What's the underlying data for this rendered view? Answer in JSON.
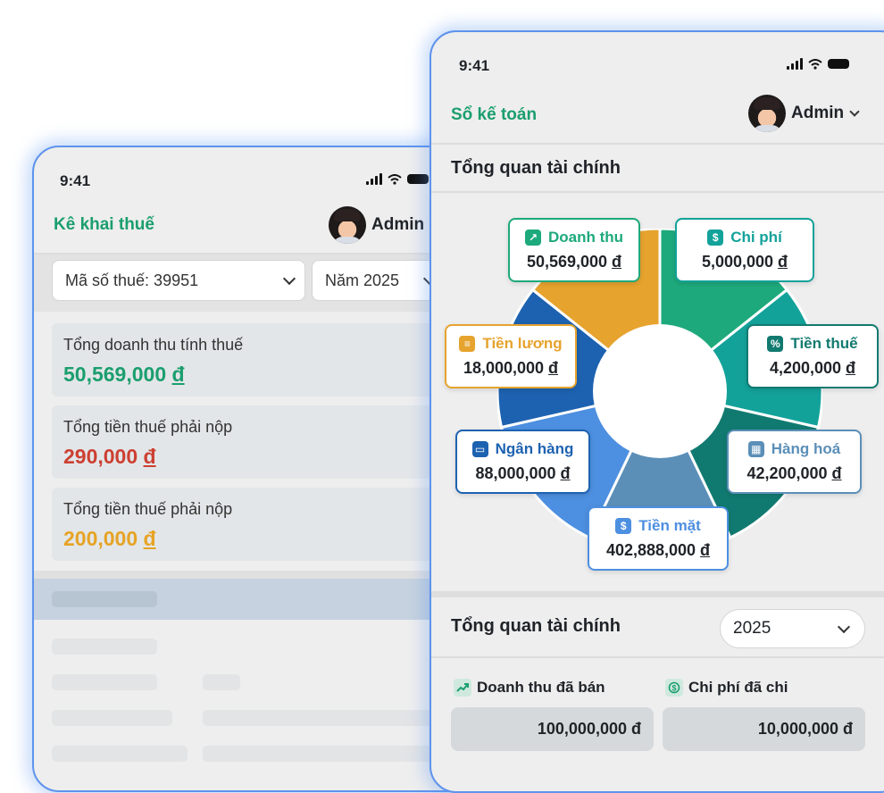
{
  "status": {
    "time": "9:41"
  },
  "tax_screen": {
    "title": "Kê khai thuế",
    "user_name": "Admin",
    "tax_code_select": "Mã số thuế: 39951",
    "year_select": "Năm 2025",
    "cards": [
      {
        "label": "Tổng doanh thu tính thuế",
        "amount": "50,569,000",
        "currency": "đ",
        "color": "#1b9e6e"
      },
      {
        "label": "Tổng tiền thuế phải nộp",
        "amount": "290,000",
        "currency": "đ",
        "color": "#cc4033"
      },
      {
        "label": "Tổng tiền thuế phải nộp",
        "amount": "200,000",
        "currency": "đ",
        "color": "#e6a325"
      }
    ]
  },
  "ledger_screen": {
    "title": "Sổ kế toán",
    "user_name": "Admin",
    "overview_title": "Tổng quan tài chính",
    "donut": {
      "segments": [
        {
          "name": "Doanh thu",
          "amount": "50,569,000",
          "currency": "đ",
          "color": "#1ea97c",
          "icon": "trend-up-icon"
        },
        {
          "name": "Chi phí",
          "amount": "5,000,000",
          "currency": "đ",
          "color": "#13a29a",
          "icon": "money-out-icon"
        },
        {
          "name": "Tiền thuế",
          "amount": "4,200,000",
          "currency": "đ",
          "color": "#117a70",
          "icon": "tax-bag-icon"
        },
        {
          "name": "Hàng hoá",
          "amount": "42,200,000",
          "currency": "đ",
          "color": "#5b8fb8",
          "icon": "boxes-icon"
        },
        {
          "name": "Tiền mặt",
          "amount": "402,888,000",
          "currency": "đ",
          "color": "#4d8fe0",
          "icon": "coin-icon"
        },
        {
          "name": "Ngân hàng",
          "amount": "88,000,000",
          "currency": "đ",
          "color": "#1d62b0",
          "icon": "card-icon"
        },
        {
          "name": "Tiền lương",
          "amount": "18,000,000",
          "currency": "đ",
          "color": "#e6a32e",
          "icon": "salary-icon"
        }
      ]
    },
    "summary": {
      "title": "Tổng quan tài chính",
      "year": "2025",
      "revenue_label": "Doanh thu đã bán",
      "revenue_value": "100,000,000 đ",
      "expense_label": "Chi phí đã chi",
      "expense_value": "10,000,000 đ"
    }
  }
}
